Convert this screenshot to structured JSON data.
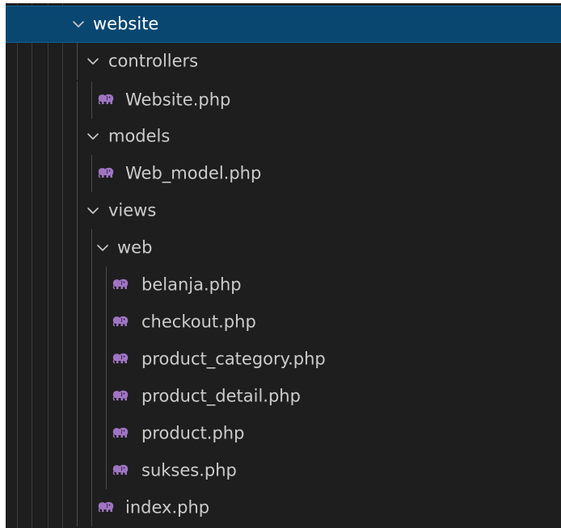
{
  "tree": {
    "root": {
      "label": "website",
      "expanded": true,
      "selected": true
    },
    "controllers": {
      "label": "controllers",
      "expanded": true
    },
    "website_php": {
      "label": "Website.php",
      "icon": "php-elephant-icon"
    },
    "models": {
      "label": "models",
      "expanded": true
    },
    "web_model_php": {
      "label": "Web_model.php",
      "icon": "php-elephant-icon"
    },
    "views": {
      "label": "views",
      "expanded": true
    },
    "web": {
      "label": "web",
      "expanded": true
    },
    "web_files": [
      {
        "label": "belanja.php",
        "icon": "php-elephant-icon"
      },
      {
        "label": "checkout.php",
        "icon": "php-elephant-icon"
      },
      {
        "label": "product_category.php",
        "icon": "php-elephant-icon"
      },
      {
        "label": "product_detail.php",
        "icon": "php-elephant-icon"
      },
      {
        "label": "product.php",
        "icon": "php-elephant-icon"
      },
      {
        "label": "sukses.php",
        "icon": "php-elephant-icon"
      }
    ],
    "index_php": {
      "label": "index.php",
      "icon": "php-elephant-icon"
    }
  },
  "colors": {
    "background": "#1e1e1e",
    "selected_row": "#094771",
    "selected_border": "#0e639c",
    "text": "#cccccc",
    "php_icon": "#a074c4",
    "indent_guide": "#4b4b4b"
  }
}
